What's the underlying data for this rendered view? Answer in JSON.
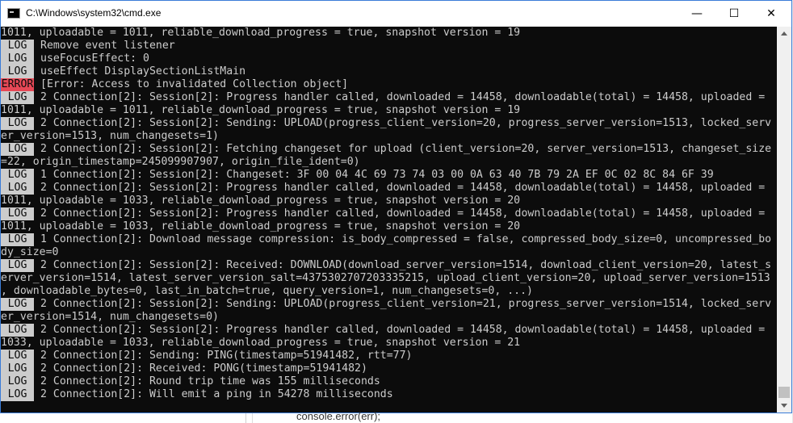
{
  "window": {
    "title": "C:\\Windows\\system32\\cmd.exe",
    "minimize_glyph": "—",
    "maximize_glyph": "☐",
    "close_glyph": "✕"
  },
  "colors": {
    "console_bg": "#0c0c0c",
    "console_text": "#cccccc",
    "log_badge_bg": "#cccccc",
    "error_badge_bg": "#e74856"
  },
  "console": {
    "lines": [
      {
        "badge": "",
        "text": "1011, uploadable = 1011, reliable_download_progress = true, snapshot version = 19"
      },
      {
        "badge": "LOG",
        "text": "Remove event listener"
      },
      {
        "badge": "LOG",
        "text": "useFocusEffect: 0"
      },
      {
        "badge": "LOG",
        "text": "useEffect DisplaySectionListMain"
      },
      {
        "badge": "ERROR",
        "text": "[Error: Access to invalidated Collection object]"
      },
      {
        "badge": "LOG",
        "text": "2 Connection[2]: Session[2]: Progress handler called, downloaded = 14458, downloadable(total) = 14458, uploaded ="
      },
      {
        "badge": "",
        "text": "1011, uploadable = 1011, reliable_download_progress = true, snapshot version = 19"
      },
      {
        "badge": "LOG",
        "text": "2 Connection[2]: Session[2]: Sending: UPLOAD(progress_client_version=20, progress_server_version=1513, locked_serv"
      },
      {
        "badge": "",
        "text": "er_version=1513, num_changesets=1)"
      },
      {
        "badge": "LOG",
        "text": "2 Connection[2]: Session[2]: Fetching changeset for upload (client_version=20, server_version=1513, changeset_size"
      },
      {
        "badge": "",
        "text": "=22, origin_timestamp=245099907907, origin_file_ident=0)"
      },
      {
        "badge": "LOG",
        "text": "1 Connection[2]: Session[2]: Changeset: 3F 00 04 4C 69 73 74 03 00 0A 63 40 7B 79 2A EF 0C 02 8C 84 6F 39"
      },
      {
        "badge": "LOG",
        "text": "2 Connection[2]: Session[2]: Progress handler called, downloaded = 14458, downloadable(total) = 14458, uploaded ="
      },
      {
        "badge": "",
        "text": "1011, uploadable = 1033, reliable_download_progress = true, snapshot version = 20"
      },
      {
        "badge": "LOG",
        "text": "2 Connection[2]: Session[2]: Progress handler called, downloaded = 14458, downloadable(total) = 14458, uploaded ="
      },
      {
        "badge": "",
        "text": "1011, uploadable = 1033, reliable_download_progress = true, snapshot version = 20"
      },
      {
        "badge": "LOG",
        "text": "1 Connection[2]: Download message compression: is_body_compressed = false, compressed_body_size=0, uncompressed_bo"
      },
      {
        "badge": "",
        "text": "dy_size=0"
      },
      {
        "badge": "LOG",
        "text": "2 Connection[2]: Session[2]: Received: DOWNLOAD(download_server_version=1514, download_client_version=20, latest_s"
      },
      {
        "badge": "",
        "text": "erver_version=1514, latest_server_version_salt=4375302707203335215, upload_client_version=20, upload_server_version=1513"
      },
      {
        "badge": "",
        "text": ", downloadable_bytes=0, last_in_batch=true, query_version=1, num_changesets=0, ...)"
      },
      {
        "badge": "LOG",
        "text": "2 Connection[2]: Session[2]: Sending: UPLOAD(progress_client_version=21, progress_server_version=1514, locked_serv"
      },
      {
        "badge": "",
        "text": "er_version=1514, num_changesets=0)"
      },
      {
        "badge": "LOG",
        "text": "2 Connection[2]: Session[2]: Progress handler called, downloaded = 14458, downloadable(total) = 14458, uploaded ="
      },
      {
        "badge": "",
        "text": "1033, uploadable = 1033, reliable_download_progress = true, snapshot version = 21"
      },
      {
        "badge": "LOG",
        "text": "2 Connection[2]: Sending: PING(timestamp=51941482, rtt=77)"
      },
      {
        "badge": "LOG",
        "text": "2 Connection[2]: Received: PONG(timestamp=51941482)"
      },
      {
        "badge": "LOG",
        "text": "2 Connection[2]: Round trip time was 155 milliseconds"
      },
      {
        "badge": "LOG",
        "text": "2 Connection[2]: Will emit a ping in 54278 milliseconds"
      }
    ]
  },
  "background": {
    "code_snippet": "console.error(err);"
  }
}
